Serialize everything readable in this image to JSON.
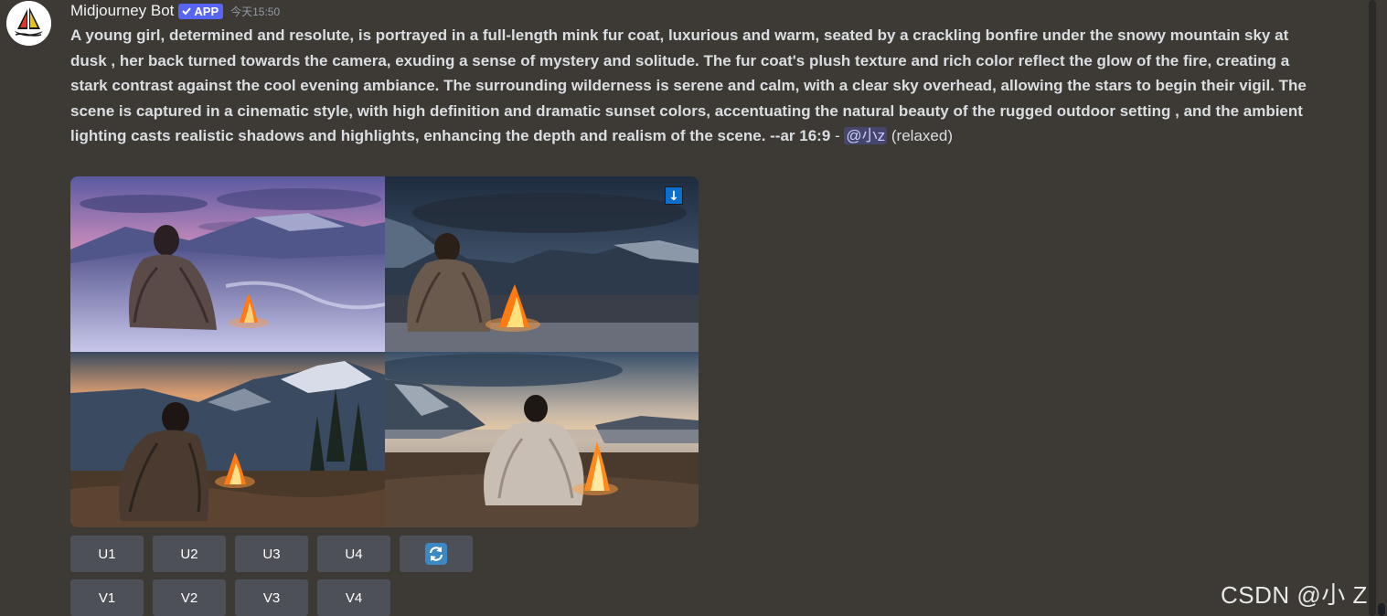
{
  "message": {
    "author": "Midjourney Bot",
    "badge": "APP",
    "timestamp": "今天15:50",
    "prompt_text": "A young girl, determined and resolute, is portrayed in a full-length mink fur coat, luxurious and warm, seated by a crackling bonfire under the snowy mountain sky at dusk , her back turned towards the camera, exuding a sense of mystery and solitude. The fur coat's plush texture and rich color reflect the glow of the fire, creating a stark contrast against the cool evening ambiance. The surrounding wilderness is serene and calm, with a clear sky overhead, allowing the stars to begin their vigil. The scene is captured in a cinematic style, with high definition and dramatic sunset colors, accentuating the natural beauty of the rugged outdoor setting , and the ambient lighting casts realistic shadows and highlights, enhancing the depth and realism of the scene. --ar 16:9",
    "separator": " - ",
    "mention": "@小z",
    "suffix": " (relaxed)"
  },
  "images": {
    "download_icon": "↓"
  },
  "buttons": {
    "upscale": [
      "U1",
      "U2",
      "U3",
      "U4"
    ],
    "reroll_icon": "refresh-icon",
    "variation": [
      "V1",
      "V2",
      "V3",
      "V4"
    ]
  },
  "watermark": "CSDN @小 Z",
  "colors": {
    "background": "#3d3935",
    "badge": "#5865f2",
    "button": "#4e5058",
    "mention_bg": "rgba(88,101,242,0.3)"
  }
}
